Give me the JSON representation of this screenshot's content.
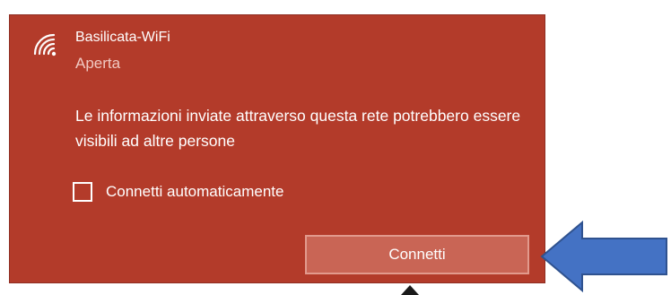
{
  "network": {
    "name": "Basilicata-WiFi",
    "status": "Aperta",
    "icon": "wifi-icon"
  },
  "warning": {
    "text": "Le informazioni inviate attraverso questa rete potrebbero essere visibili ad altre persone"
  },
  "auto_connect": {
    "label": "Connetti automaticamente",
    "checked": false
  },
  "connect_button": {
    "label": "Connetti"
  },
  "colors": {
    "panel_background": "#b33b2a",
    "button_background": "#c96555",
    "button_border": "#e29a8d",
    "annotation_arrow": "#4472c4"
  }
}
